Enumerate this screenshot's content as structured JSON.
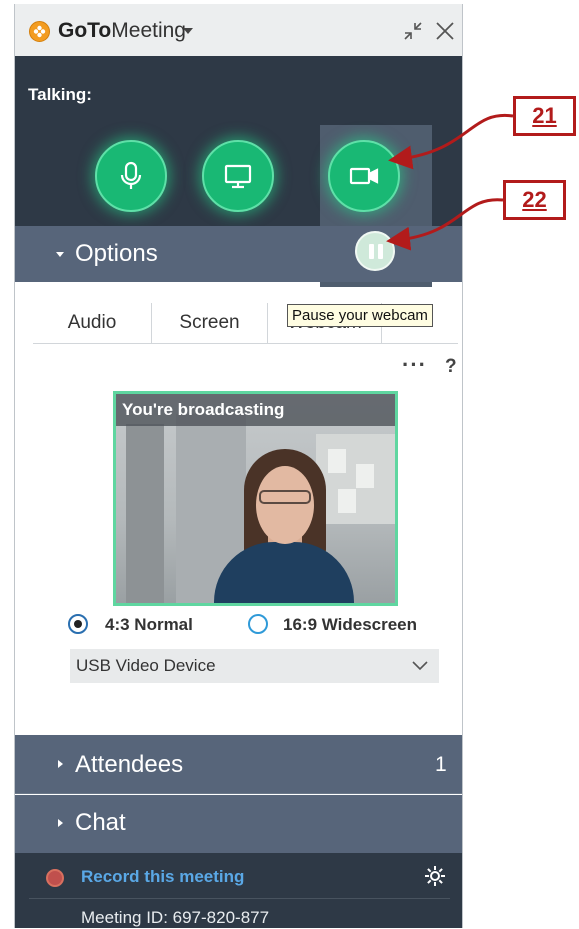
{
  "window": {
    "app_name_bold": "GoTo",
    "app_name_rest": "Meeting"
  },
  "talking": {
    "label": "Talking:"
  },
  "controls": {
    "mic": "microphone-icon",
    "screen": "screen-share-icon",
    "webcam": "webcam-icon",
    "pause": "pause-icon"
  },
  "options": {
    "header": "Options",
    "tabs": [
      "Audio",
      "Screen",
      "Webcam"
    ],
    "tooltip": "Pause your webcam",
    "more": "···",
    "help": "?",
    "preview_label": "You're broadcasting",
    "aspect": [
      {
        "label": "4:3 Normal",
        "selected": true
      },
      {
        "label": "16:9 Widescreen",
        "selected": false
      }
    ],
    "device": "USB Video Device"
  },
  "attendees": {
    "header": "Attendees",
    "count": "1"
  },
  "chat": {
    "header": "Chat"
  },
  "footer": {
    "record": "Record this meeting",
    "meeting_id": "Meeting ID: 697-820-877"
  },
  "callouts": [
    "21",
    "22"
  ],
  "colors": {
    "accent_green": "#19b874",
    "header_slate": "#57657a",
    "dark_bar": "#2e3946",
    "callout_red": "#b21b1b",
    "link_blue": "#5aa8e6"
  }
}
